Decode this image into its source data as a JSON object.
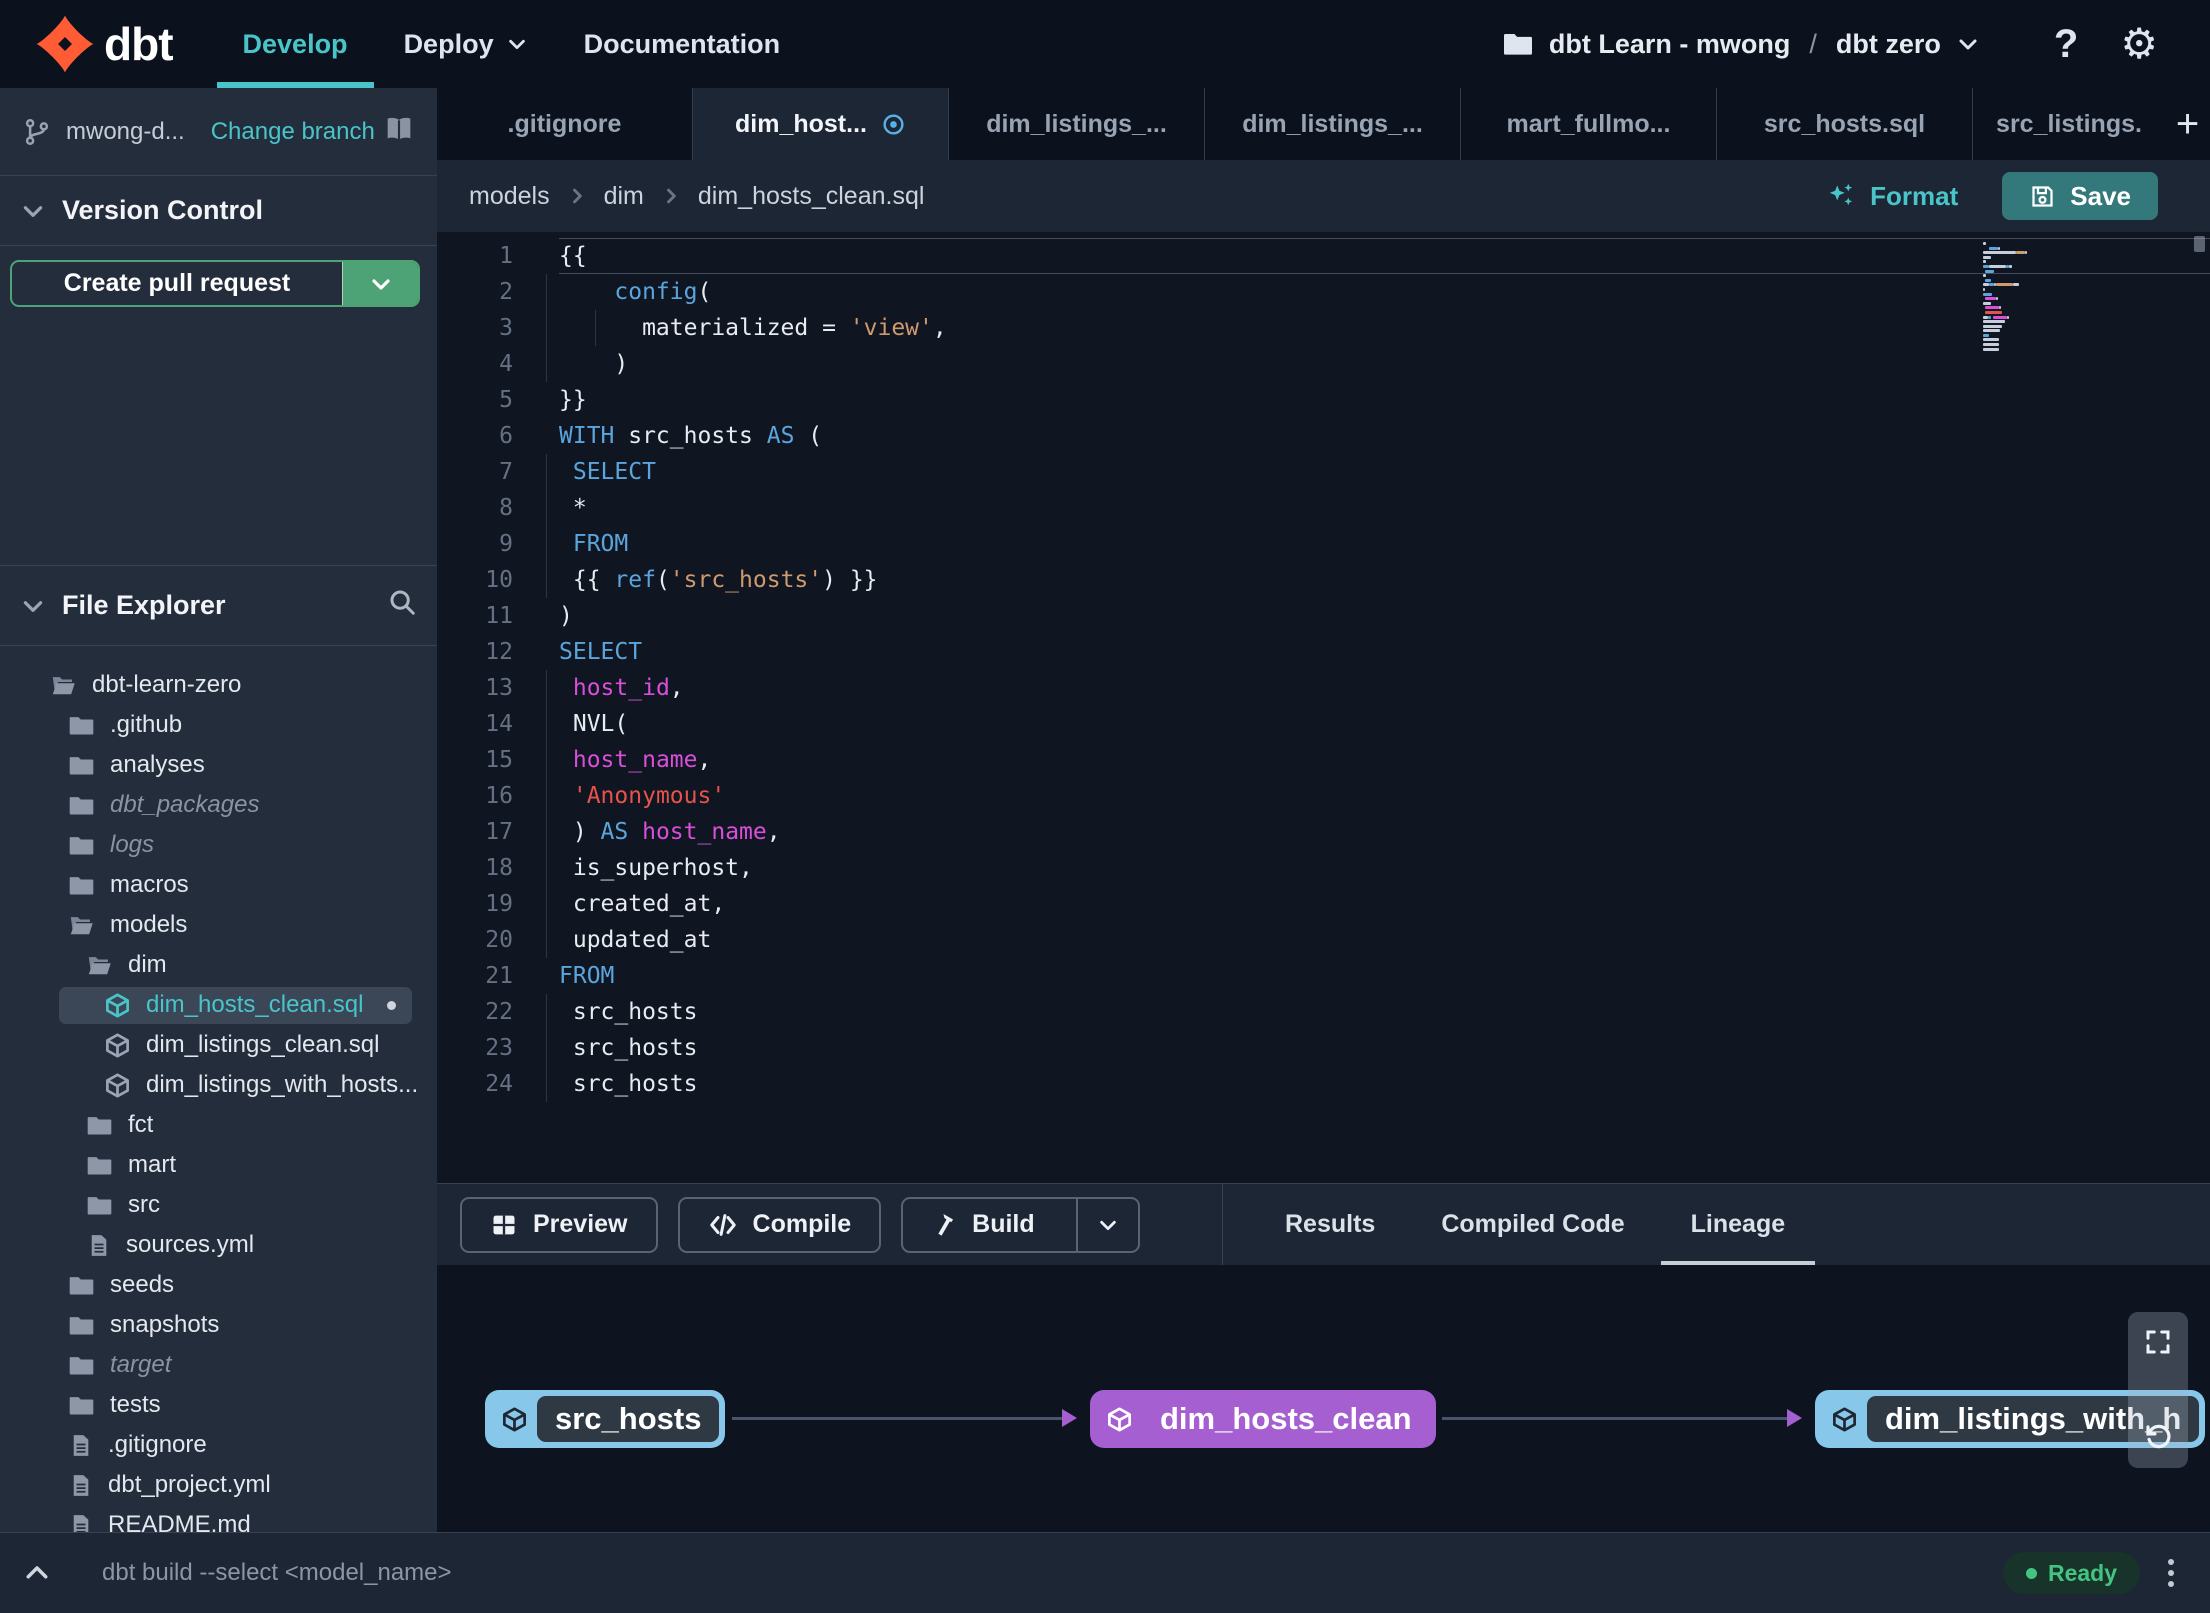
{
  "colors": {
    "brand_orange": "#ff5c35",
    "accent_teal": "#49c5c9",
    "save_button_teal": "#33787a",
    "pr_button_green": "#4ea376",
    "status_green": "#43c581",
    "node_blue": "#86c7ea",
    "node_purple": "#a55fd1",
    "modified_blue": "#57b1e8"
  },
  "navbar": {
    "logo_text": "dbt",
    "items": [
      {
        "label": "Develop",
        "active": true
      },
      {
        "label": "Deploy",
        "chevron": true
      },
      {
        "label": "Documentation"
      }
    ],
    "account": {
      "name": "dbt Learn - mwong",
      "separator": "/",
      "project": "dbt zero"
    }
  },
  "sidebar": {
    "branch": {
      "name": "mwong-d...",
      "change_label": "Change branch"
    },
    "version_control": {
      "title": "Version Control",
      "create_pr_label": "Create pull request"
    },
    "file_explorer": {
      "title": "File Explorer"
    },
    "tree": [
      {
        "label": "dbt-learn-zero",
        "icon": "folder-open",
        "level": 1
      },
      {
        "label": ".github",
        "icon": "folder",
        "level": 2
      },
      {
        "label": "analyses",
        "icon": "folder",
        "level": 2
      },
      {
        "label": "dbt_packages",
        "icon": "folder",
        "level": 2,
        "muted": true
      },
      {
        "label": "logs",
        "icon": "folder",
        "level": 2,
        "muted": true
      },
      {
        "label": "macros",
        "icon": "folder",
        "level": 2
      },
      {
        "label": "models",
        "icon": "folder-open",
        "level": 2
      },
      {
        "label": "dim",
        "icon": "folder-open",
        "level": 3
      },
      {
        "label": "dim_hosts_clean.sql",
        "icon": "cube",
        "level": 4,
        "selected": true,
        "modified": true
      },
      {
        "label": "dim_listings_clean.sql",
        "icon": "cube",
        "level": 4
      },
      {
        "label": "dim_listings_with_hosts...",
        "icon": "cube",
        "level": 4
      },
      {
        "label": "fct",
        "icon": "folder",
        "level": 3
      },
      {
        "label": "mart",
        "icon": "folder",
        "level": 3
      },
      {
        "label": "src",
        "icon": "folder",
        "level": 3
      },
      {
        "label": "sources.yml",
        "icon": "file",
        "level": 3
      },
      {
        "label": "seeds",
        "icon": "folder",
        "level": 2
      },
      {
        "label": "snapshots",
        "icon": "folder",
        "level": 2
      },
      {
        "label": "target",
        "icon": "folder",
        "level": 2,
        "muted": true
      },
      {
        "label": "tests",
        "icon": "folder",
        "level": 2
      },
      {
        "label": ".gitignore",
        "icon": "file",
        "level": 2
      },
      {
        "label": "dbt_project.yml",
        "icon": "file",
        "level": 2
      },
      {
        "label": "README.md",
        "icon": "file",
        "level": 2
      }
    ]
  },
  "tabs": [
    {
      "label": ".gitignore"
    },
    {
      "label": "dim_host...",
      "active": true,
      "modified": true
    },
    {
      "label": "dim_listings_..."
    },
    {
      "label": "dim_listings_..."
    },
    {
      "label": "mart_fullmo..."
    },
    {
      "label": "src_hosts.sql"
    },
    {
      "label": "src_listings.",
      "clipped": true
    }
  ],
  "editor_header": {
    "breadcrumb": [
      "models",
      "dim",
      "dim_hosts_clean.sql"
    ],
    "format_label": "Format",
    "save_label": "Save"
  },
  "editor": {
    "lines": [
      {
        "n": 1,
        "current": true,
        "guides": [],
        "tokens": [
          [
            "plain",
            "{{"
          ]
        ]
      },
      {
        "n": 2,
        "guides": [
          -13
        ],
        "tokens": [
          [
            "plain",
            "    "
          ],
          [
            "kw",
            "config"
          ],
          [
            "plain",
            "("
          ]
        ]
      },
      {
        "n": 3,
        "guides": [
          -13,
          36
        ],
        "tokens": [
          [
            "plain",
            "      materialized = "
          ],
          [
            "str",
            "'view'"
          ],
          [
            "plain",
            ","
          ]
        ]
      },
      {
        "n": 4,
        "guides": [
          -13
        ],
        "tokens": [
          [
            "plain",
            "    )"
          ]
        ]
      },
      {
        "n": 5,
        "guides": [],
        "tokens": [
          [
            "plain",
            "}}"
          ]
        ]
      },
      {
        "n": 6,
        "guides": [],
        "tokens": [
          [
            "kw",
            "WITH"
          ],
          [
            "plain",
            " src_hosts "
          ],
          [
            "kw",
            "AS"
          ],
          [
            "plain",
            " ("
          ]
        ]
      },
      {
        "n": 7,
        "guides": [
          -13
        ],
        "tokens": [
          [
            "plain",
            " "
          ],
          [
            "kw",
            "SELECT"
          ]
        ]
      },
      {
        "n": 8,
        "guides": [
          -13
        ],
        "tokens": [
          [
            "plain",
            " *"
          ]
        ]
      },
      {
        "n": 9,
        "guides": [
          -13
        ],
        "tokens": [
          [
            "plain",
            " "
          ],
          [
            "kw",
            "FROM"
          ]
        ]
      },
      {
        "n": 10,
        "guides": [
          -13
        ],
        "tokens": [
          [
            "plain",
            " {{ "
          ],
          [
            "kw",
            "ref"
          ],
          [
            "plain",
            "("
          ],
          [
            "str",
            "'src_hosts'"
          ],
          [
            "plain",
            ") }}"
          ]
        ]
      },
      {
        "n": 11,
        "guides": [],
        "tokens": [
          [
            "plain",
            ")"
          ]
        ]
      },
      {
        "n": 12,
        "guides": [],
        "tokens": [
          [
            "kw",
            "SELECT"
          ]
        ]
      },
      {
        "n": 13,
        "guides": [
          -13
        ],
        "tokens": [
          [
            "plain",
            " "
          ],
          [
            "field",
            "host_id"
          ],
          [
            "plain",
            ","
          ]
        ]
      },
      {
        "n": 14,
        "guides": [
          -13
        ],
        "tokens": [
          [
            "plain",
            " NVL("
          ]
        ]
      },
      {
        "n": 15,
        "guides": [
          -13
        ],
        "tokens": [
          [
            "plain",
            " "
          ],
          [
            "field",
            "host_name"
          ],
          [
            "plain",
            ","
          ]
        ]
      },
      {
        "n": 16,
        "guides": [
          -13
        ],
        "tokens": [
          [
            "plain",
            " "
          ],
          [
            "strred",
            "'Anonymous'"
          ]
        ]
      },
      {
        "n": 17,
        "guides": [
          -13
        ],
        "tokens": [
          [
            "plain",
            " ) "
          ],
          [
            "kw",
            "AS"
          ],
          [
            "plain",
            " "
          ],
          [
            "field",
            "host_name"
          ],
          [
            "plain",
            ","
          ]
        ]
      },
      {
        "n": 18,
        "guides": [
          -13
        ],
        "tokens": [
          [
            "plain",
            " is_superhost,"
          ]
        ]
      },
      {
        "n": 19,
        "guides": [
          -13
        ],
        "tokens": [
          [
            "plain",
            " created_at,"
          ]
        ]
      },
      {
        "n": 20,
        "guides": [
          -13
        ],
        "tokens": [
          [
            "plain",
            " updated_at"
          ]
        ]
      },
      {
        "n": 21,
        "guides": [],
        "tokens": [
          [
            "kw",
            "FROM"
          ]
        ]
      },
      {
        "n": 22,
        "guides": [
          -13
        ],
        "tokens": [
          [
            "plain",
            " src_hosts"
          ]
        ]
      },
      {
        "n": 23,
        "guides": [
          -13
        ],
        "tokens": [
          [
            "plain",
            " src_hosts"
          ]
        ]
      },
      {
        "n": 24,
        "guides": [
          -13
        ],
        "tokens": [
          [
            "plain",
            " src_hosts"
          ]
        ]
      }
    ]
  },
  "action_bar": {
    "run_buttons": [
      {
        "label": "Preview",
        "icon": "table"
      },
      {
        "label": "Compile",
        "icon": "code"
      },
      {
        "label": "Build",
        "icon": "hammer",
        "split": true
      }
    ],
    "panel_tabs": [
      {
        "label": "Results"
      },
      {
        "label": "Compiled Code"
      },
      {
        "label": "Lineage",
        "active": true
      }
    ]
  },
  "lineage": {
    "nodes": [
      {
        "label": "src_hosts",
        "style": "blue"
      },
      {
        "label": "dim_hosts_clean",
        "style": "purple"
      },
      {
        "label": "dim_listings_with_h",
        "style": "blue"
      }
    ]
  },
  "status_bar": {
    "command": "dbt build --select <model_name>",
    "ready_label": "Ready"
  }
}
